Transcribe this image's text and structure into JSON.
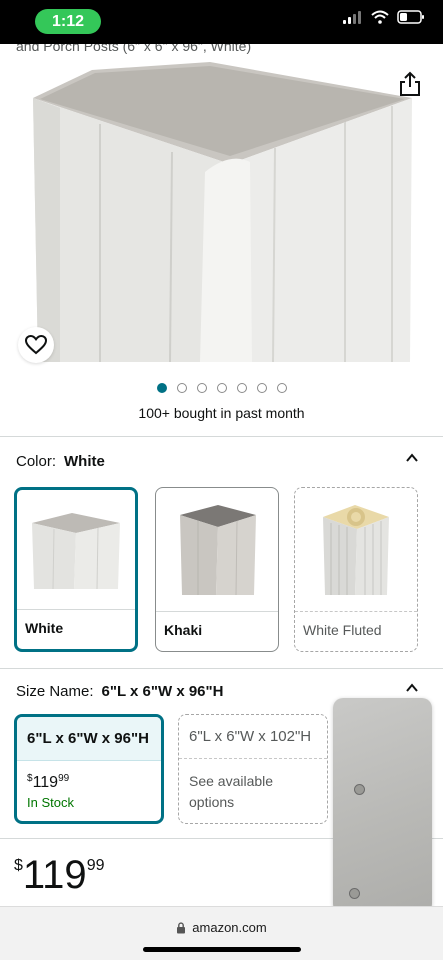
{
  "status_bar": {
    "time": "1:12",
    "accent": "#34c759"
  },
  "product": {
    "title_fragment": "and Porch Posts (6\" x 6\" x 96\", White)",
    "bought_text": "100+ bought in past month",
    "image_count": 7,
    "active_image_index": 0
  },
  "color_section": {
    "label": "Color:",
    "selected_value": "White",
    "options": [
      {
        "label": "White",
        "state": "selected"
      },
      {
        "label": "Khaki",
        "state": "available"
      },
      {
        "label": "White Fluted",
        "state": "unavailable"
      }
    ]
  },
  "size_section": {
    "label": "Size Name:",
    "selected_value": "6\"L x 6\"W x 96\"H",
    "options": [
      {
        "label": "6\"L x 6\"W x 96\"H",
        "price_whole": "119",
        "price_fraction": "99",
        "currency": "$",
        "availability": "In Stock",
        "state": "selected"
      },
      {
        "label": "6\"L x 6\"W x 102\"H",
        "note": "See available options",
        "state": "unavailable"
      }
    ]
  },
  "price": {
    "currency": "$",
    "whole": "119",
    "fraction": "99"
  },
  "browser": {
    "url": "amazon.com"
  },
  "icons": {
    "share": "share-icon",
    "wishlist": "heart-icon",
    "collapse": "chevron-up-icon",
    "lock": "lock-icon"
  },
  "colors": {
    "accent_teal": "#007185",
    "in_stock_green": "#007600"
  }
}
